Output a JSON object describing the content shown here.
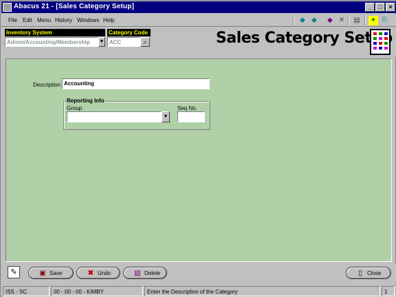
{
  "window": {
    "title": "Abacus 21 - [Sales Category Setup]"
  },
  "menu": {
    "items": [
      "File",
      "Edit",
      "Menu",
      "History",
      "Windows",
      "Help"
    ]
  },
  "header": {
    "inventory_system_label": "Inventory System",
    "inventory_system_value": "Admin/Accounting/Membership",
    "category_code_label": "Category Code",
    "category_code_value": "ACC",
    "page_title": "Sales Category Setup"
  },
  "form": {
    "description_label": "Description",
    "description_value": "Accounting",
    "reporting_info_label": "Reporting Info",
    "group_label": "Group",
    "group_value": "",
    "seq_no_label": "Seq No.",
    "seq_no_value": ""
  },
  "footer": {
    "save_label": "Save",
    "undo_label": "Undo",
    "delete_label": "Delete",
    "close_label": "Close"
  },
  "statusbar": {
    "screen_code": "ISS - SC",
    "session": "00 - 00 - 00 - KIMBY",
    "hint": "Enter the Description of the Category",
    "page": "1"
  }
}
